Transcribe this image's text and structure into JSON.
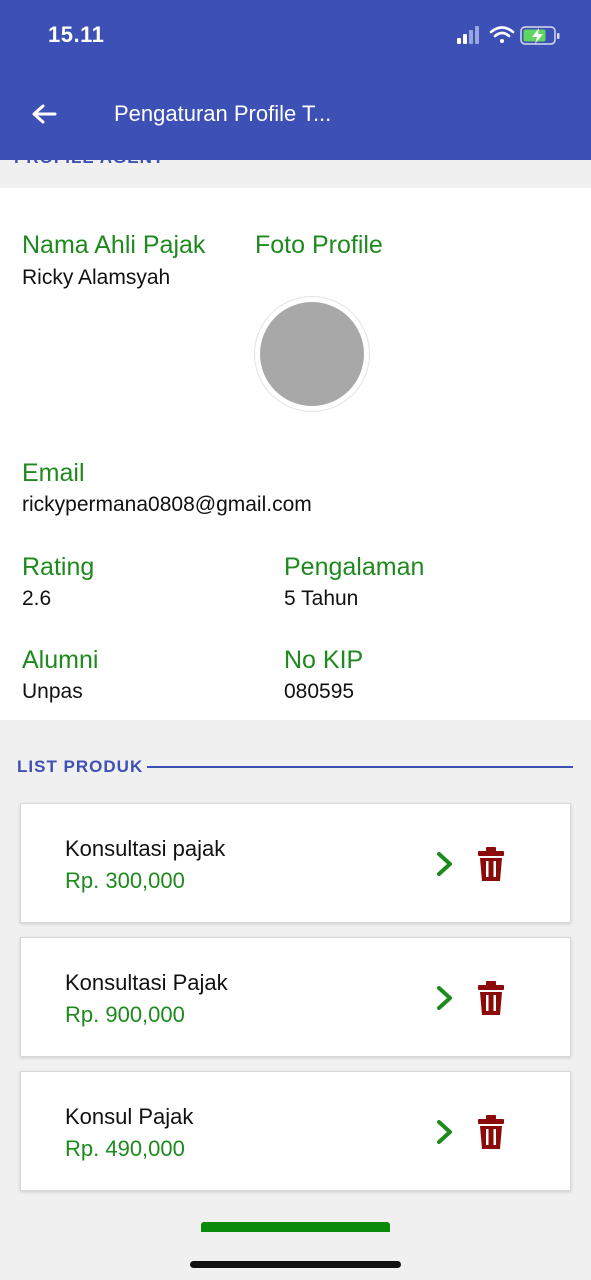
{
  "status_bar": {
    "time": "15.11"
  },
  "app_bar": {
    "title": "Pengaturan Profile T..."
  },
  "section": {
    "profile_title": "PROFILE AGENT"
  },
  "profile": {
    "name_label": "Nama Ahli Pajak",
    "name_value": "Ricky Alamsyah",
    "photo_label": "Foto Profile",
    "email_label": "Email",
    "email_value": "rickypermana0808@gmail.com",
    "rating_label": "Rating",
    "rating_value": "2.6",
    "experience_label": "Pengalaman",
    "experience_value": "5 Tahun",
    "alumni_label": "Alumni",
    "alumni_value": "Unpas",
    "kip_label": "No KIP",
    "kip_value": "080595"
  },
  "list": {
    "title": "LIST PRODUK",
    "products": [
      {
        "name": "Konsultasi pajak",
        "price": "Rp. 300,000"
      },
      {
        "name": "Konsultasi Pajak",
        "price": "Rp. 900,000"
      },
      {
        "name": "Konsul Pajak",
        "price": "Rp. 490,000"
      }
    ]
  },
  "colors": {
    "primary": "#3d50b5",
    "label_green": "#1e8a1e",
    "delete_red": "#8b0a0a",
    "background": "#f0f0f0"
  },
  "icons": {
    "back": "arrow-left-icon",
    "signal": "cellular-signal-icon",
    "wifi": "wifi-icon",
    "battery": "battery-charging-icon",
    "chevron": "chevron-right-icon",
    "delete": "trash-icon"
  }
}
